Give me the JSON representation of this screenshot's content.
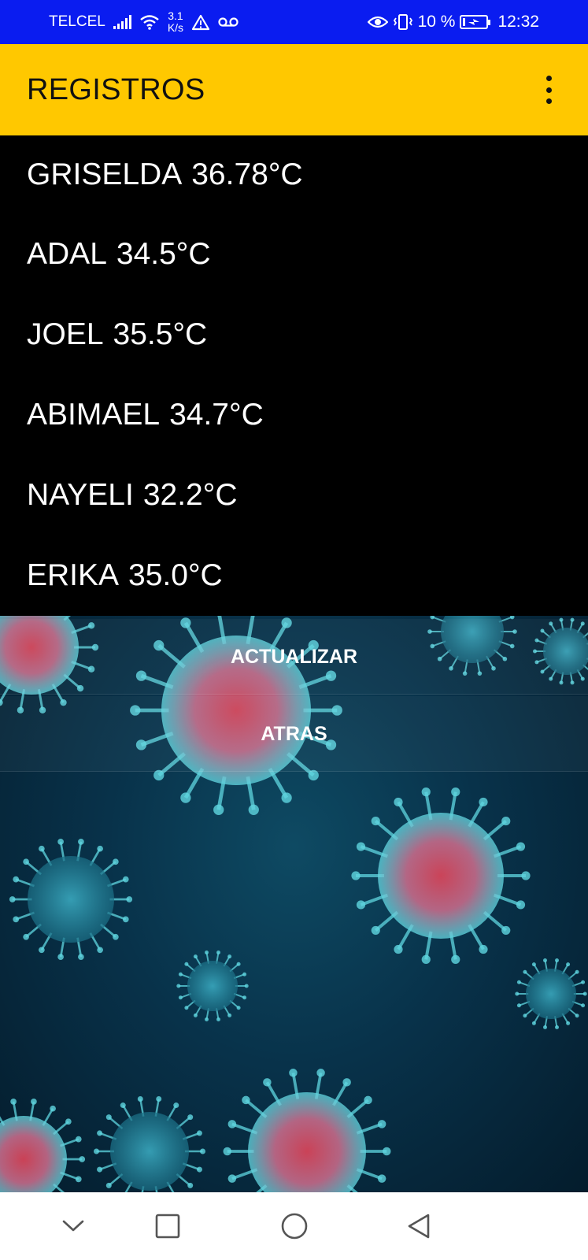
{
  "status_bar": {
    "carrier": "TELCEL",
    "speed_value": "3.1",
    "speed_unit": "K/s",
    "battery": "10 %",
    "time": "12:32",
    "icons": [
      "signal-icon",
      "wifi-icon",
      "warning-icon",
      "voicemail-icon",
      "eye-icon",
      "vibrate-icon",
      "battery-icon"
    ]
  },
  "app_bar": {
    "title": "REGISTROS",
    "menu_icon": "more-vert-icon"
  },
  "records": [
    {
      "name": "GRISELDA",
      "temperature": "36.78°C"
    },
    {
      "name": "ADAL",
      "temperature": "34.5°C"
    },
    {
      "name": "JOEL",
      "temperature": "35.5°C"
    },
    {
      "name": "ABIMAEL",
      "temperature": "34.7°C"
    },
    {
      "name": "NAYELI",
      "temperature": "32.2°C"
    },
    {
      "name": "ERIKA",
      "temperature": "35.0°C"
    }
  ],
  "buttons": {
    "update_label": "ACTUALIZAR",
    "back_label": "ATRAS"
  },
  "background": {
    "description_icon": "virus-background-image"
  },
  "nav_bar": {
    "icons": [
      "chevron-down-icon",
      "square-icon",
      "circle-icon",
      "back-triangle-icon"
    ]
  },
  "colors": {
    "status_bar": "#0a1cf0",
    "app_bar": "#ffc800",
    "list_background": "#000000",
    "virus_cyan": "#5fd6e0",
    "virus_red": "#e0455a"
  }
}
